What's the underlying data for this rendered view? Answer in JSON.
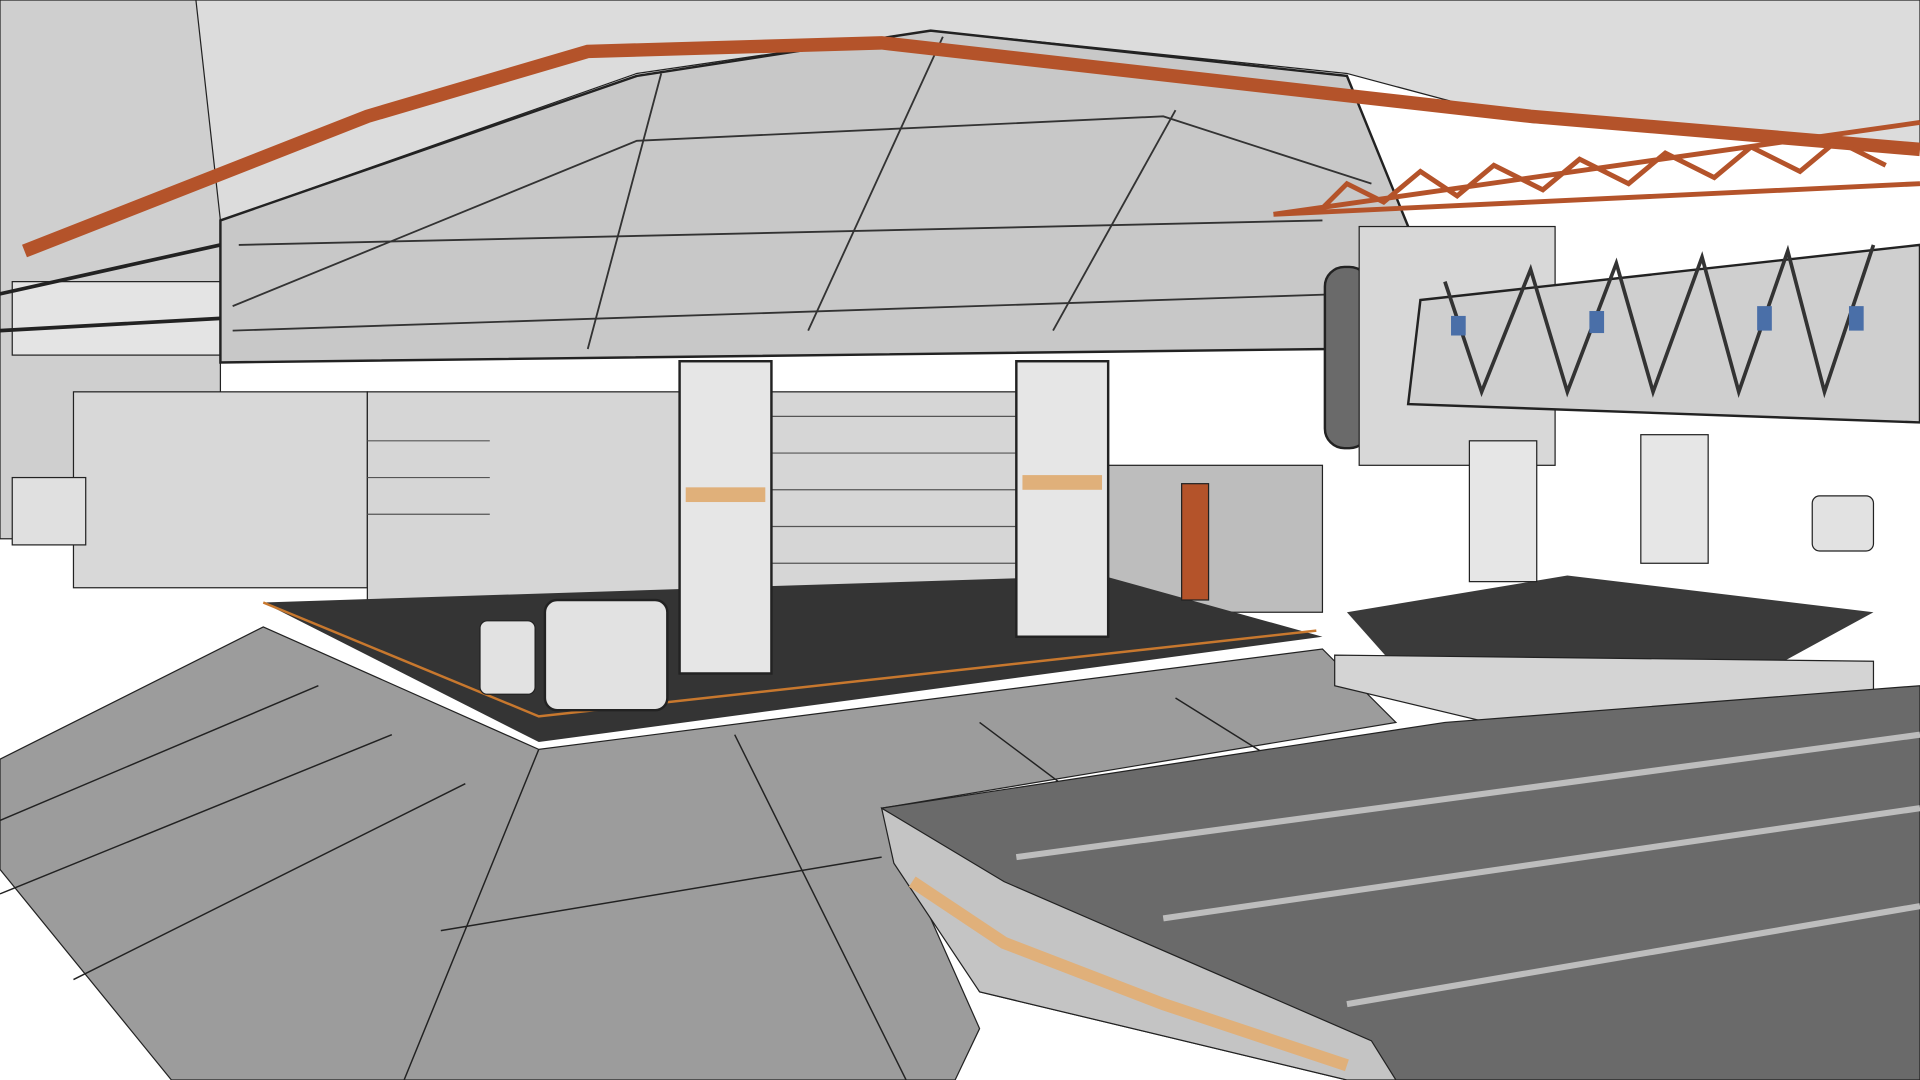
{
  "scene": {
    "colors": {
      "background": "#ffffff",
      "ground": "#9c9c9c",
      "runway": "#6a6a6a",
      "runway_side": "#c4c4c4",
      "hull": "#c9c9c9",
      "hull_light": "#dedede",
      "wall": "#d6d6d6",
      "floor": "#343434",
      "pipe": "#b4532a",
      "accent": "#e0b07a",
      "line": "#222222",
      "window": "#4a6fa8"
    }
  }
}
